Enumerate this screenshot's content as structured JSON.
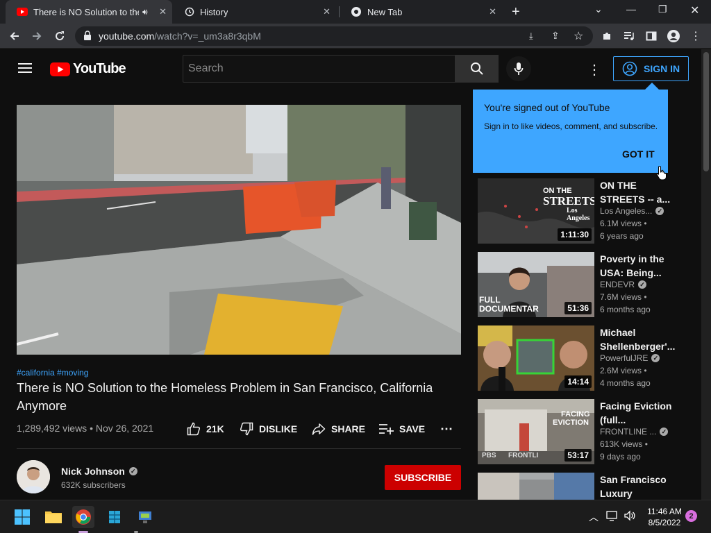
{
  "browser": {
    "tabs": [
      {
        "title": "There is NO Solution to the"
      },
      {
        "title": "History"
      },
      {
        "title": "New Tab"
      }
    ],
    "url": {
      "host": "youtube.com",
      "path": "/watch?v=_um3a8r3qbM"
    }
  },
  "youtube": {
    "logo_text": "YouTube",
    "search_placeholder": "Search",
    "sign_in_label": "SIGN IN"
  },
  "popup": {
    "title": "You're signed out of YouTube",
    "body": "Sign in to like videos, comment, and subscribe.",
    "button": "GOT IT"
  },
  "video": {
    "hashtags": "#california #moving",
    "title": "There is NO Solution to the Homeless Problem in San Francisco, California Anymore",
    "views": "1,289,492 views",
    "date": "Nov 26, 2021",
    "likes": "21K",
    "dislike_label": "DISLIKE",
    "share_label": "SHARE",
    "save_label": "SAVE"
  },
  "channel": {
    "name": "Nick Johnson",
    "subscribers": "632K subscribers",
    "subscribe_label": "SUBSCRIBE"
  },
  "recommendations": [
    {
      "title_l1": "ON THE",
      "title_l2": "STREETS -- a...",
      "channel": "Los Angeles...",
      "views": "6.1M views •",
      "age": "6 years ago",
      "duration": "1:11:30",
      "thumb_text_1": "ON THE",
      "thumb_text_2": "STREETS",
      "thumb_text_3": "Los Angeles"
    },
    {
      "title_l1": "Poverty in the",
      "title_l2": "USA: Being...",
      "channel": "ENDEVR",
      "views": "7.6M views •",
      "age": "6 months ago",
      "duration": "51:36",
      "thumb_text_1": "FULL",
      "thumb_text_2": "DOCUMENTAR"
    },
    {
      "title_l1": "Michael",
      "title_l2": "Shellenberger'...",
      "channel": "PowerfulJRE",
      "views": "2.6M views •",
      "age": "4 months ago",
      "duration": "14:14"
    },
    {
      "title_l1": "Facing Eviction",
      "title_l2": "(full...",
      "channel": "FRONTLINE ...",
      "views": "613K views •",
      "age": "9 days ago",
      "duration": "53:17",
      "thumb_text_1": "FACING",
      "thumb_text_2": "EVICTION",
      "thumb_text_3": "PBS",
      "thumb_text_4": "FRONTLI"
    },
    {
      "title_l1": "San Francisco",
      "title_l2": "Luxury Condo..."
    }
  ],
  "taskbar": {
    "time": "11:46 AM",
    "date": "8/5/2022",
    "notifications": "2"
  },
  "colors": {
    "accent_blue": "#3ea6ff",
    "subscribe_red": "#cc0000",
    "youtube_red": "#ff0000"
  }
}
